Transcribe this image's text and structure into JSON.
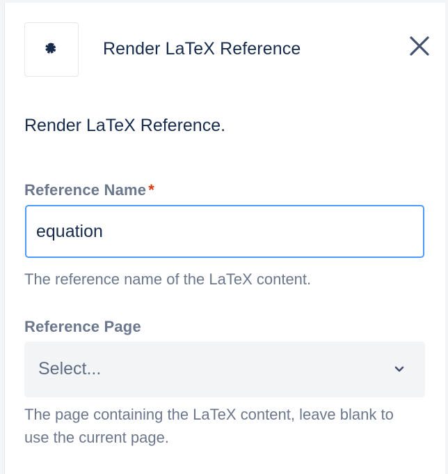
{
  "header": {
    "title": "Render LaTeX Reference",
    "icon": "puzzle-icon",
    "close_icon": "close-icon"
  },
  "description": "Render LaTeX Reference.",
  "fields": {
    "reference_name": {
      "label": "Reference Name",
      "required_mark": "*",
      "value": "equation",
      "help": "The reference name of the LaTeX content."
    },
    "reference_page": {
      "label": "Reference Page",
      "placeholder": "Select...",
      "help": "The page containing the LaTeX content, leave blank to use the current page."
    }
  },
  "colors": {
    "text": "#172b4d",
    "muted": "#6b778c",
    "focus_border": "#4c9aff",
    "required": "#de350b",
    "select_bg": "#f2f4f6"
  }
}
